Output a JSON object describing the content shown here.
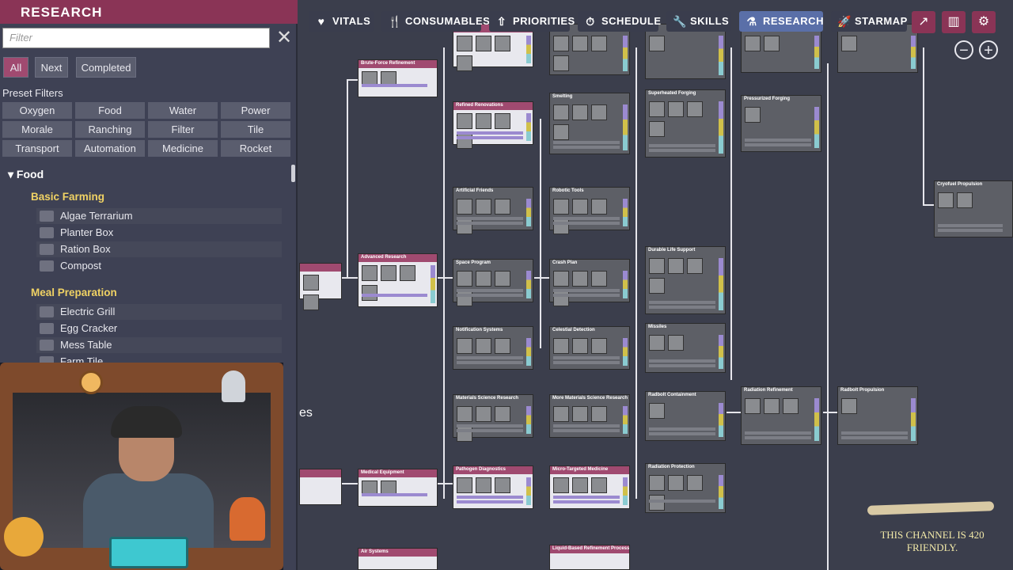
{
  "left_panel": {
    "title": "RESEARCH",
    "filter_placeholder": "Filter",
    "clear_glyph": "✕",
    "segments": [
      "All",
      "Next",
      "Completed"
    ],
    "preset_label": "Preset Filters",
    "preset_filters": [
      "Oxygen",
      "Food",
      "Water",
      "Power",
      "Morale",
      "Ranching",
      "Filter",
      "Tile",
      "Transport",
      "Automation",
      "Medicine",
      "Rocket"
    ],
    "category": "Food",
    "groups": [
      {
        "name": "Basic Farming",
        "items": [
          "Algae Terrarium",
          "Planter Box",
          "Ration Box",
          "Compost"
        ]
      },
      {
        "name": "Meal Preparation",
        "items": [
          "Electric Grill",
          "Egg Cracker",
          "Mess Table",
          "Farm Tile"
        ]
      }
    ]
  },
  "top_tabs": [
    {
      "label": "VITALS",
      "icon": "heart-icon",
      "glyph": "♥"
    },
    {
      "label": "CONSUMABLES",
      "icon": "fork-icon",
      "glyph": "🍴"
    },
    {
      "label": "PRIORITIES",
      "icon": "priority-icon",
      "glyph": "⇧"
    },
    {
      "label": "SCHEDULE",
      "icon": "clock-icon",
      "glyph": "⏱"
    },
    {
      "label": "SKILLS",
      "icon": "wrench-icon",
      "glyph": "🔧"
    },
    {
      "label": "RESEARCH",
      "icon": "flask-icon",
      "glyph": "⚗"
    },
    {
      "label": "STARMAP",
      "icon": "rocket-icon",
      "glyph": "🚀"
    }
  ],
  "active_tab": "RESEARCH",
  "nodes": [
    {
      "id": "brute-force",
      "title": "Brute-Force Refinement",
      "done": true
    },
    {
      "id": "refined-renovations",
      "title": "Refined Renovations",
      "done": true
    },
    {
      "id": "smelting",
      "title": "Smelting",
      "done": false
    },
    {
      "id": "superheated-forging",
      "title": "Superheated Forging",
      "done": false
    },
    {
      "id": "pressurized-forging",
      "title": "Pressurized Forging",
      "done": false
    },
    {
      "id": "artificial-friends",
      "title": "Artificial Friends",
      "done": false
    },
    {
      "id": "robotic-tools",
      "title": "Robotic Tools",
      "done": false
    },
    {
      "id": "cryofuel",
      "title": "Cryofuel Propulsion",
      "done": false
    },
    {
      "id": "advanced-research",
      "title": "Advanced Research",
      "done": true
    },
    {
      "id": "space-program",
      "title": "Space Program",
      "done": false
    },
    {
      "id": "crash-plan",
      "title": "Crash Plan",
      "done": false
    },
    {
      "id": "durable-life",
      "title": "Durable Life Support",
      "done": false
    },
    {
      "id": "notification",
      "title": "Notification Systems",
      "done": false
    },
    {
      "id": "celestial",
      "title": "Celestial Detection",
      "done": false
    },
    {
      "id": "missiles",
      "title": "Missiles",
      "done": false
    },
    {
      "id": "materials-science",
      "title": "Materials Science Research",
      "done": false
    },
    {
      "id": "more-materials",
      "title": "More Materials Science Research",
      "done": false
    },
    {
      "id": "radbolt-containment",
      "title": "Radbolt Containment",
      "done": false
    },
    {
      "id": "radiation-refinement",
      "title": "Radiation Refinement",
      "done": false
    },
    {
      "id": "radbolt-propulsion",
      "title": "Radbolt Propulsion",
      "done": false
    },
    {
      "id": "medical-equipment",
      "title": "Medical Equipment",
      "done": true
    },
    {
      "id": "pathogen",
      "title": "Pathogen Diagnostics",
      "done": true
    },
    {
      "id": "micro-targeted",
      "title": "Micro-Targeted Medicine",
      "done": true
    },
    {
      "id": "radiation-protection",
      "title": "Radiation Protection",
      "done": false
    },
    {
      "id": "hvac",
      "title": "Air Systems",
      "done": true
    },
    {
      "id": "liquid-refinement",
      "title": "Liquid-Based Refinement Processes",
      "done": true
    }
  ],
  "partial_label": "es",
  "overlay_text": "THIS CHANNEL IS 420 FRIENDLY."
}
